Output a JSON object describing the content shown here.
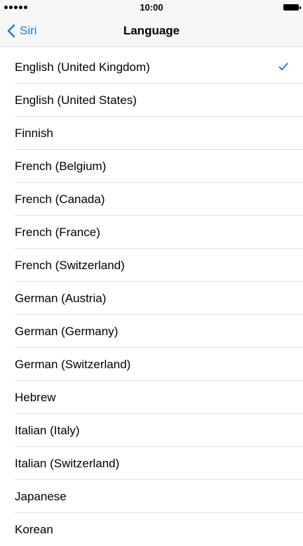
{
  "status_bar": {
    "time": "10:00"
  },
  "nav": {
    "back_label": "Siri",
    "title": "Language"
  },
  "colors": {
    "accent": "#1a7cf4"
  },
  "languages": [
    {
      "label": "English (United Kingdom)",
      "selected": true
    },
    {
      "label": "English (United States)",
      "selected": false
    },
    {
      "label": "Finnish",
      "selected": false
    },
    {
      "label": "French (Belgium)",
      "selected": false
    },
    {
      "label": "French (Canada)",
      "selected": false
    },
    {
      "label": "French (France)",
      "selected": false
    },
    {
      "label": "French (Switzerland)",
      "selected": false
    },
    {
      "label": "German (Austria)",
      "selected": false
    },
    {
      "label": "German (Germany)",
      "selected": false
    },
    {
      "label": "German (Switzerland)",
      "selected": false
    },
    {
      "label": "Hebrew",
      "selected": false
    },
    {
      "label": "Italian (Italy)",
      "selected": false
    },
    {
      "label": "Italian (Switzerland)",
      "selected": false
    },
    {
      "label": "Japanese",
      "selected": false
    },
    {
      "label": "Korean",
      "selected": false
    }
  ]
}
